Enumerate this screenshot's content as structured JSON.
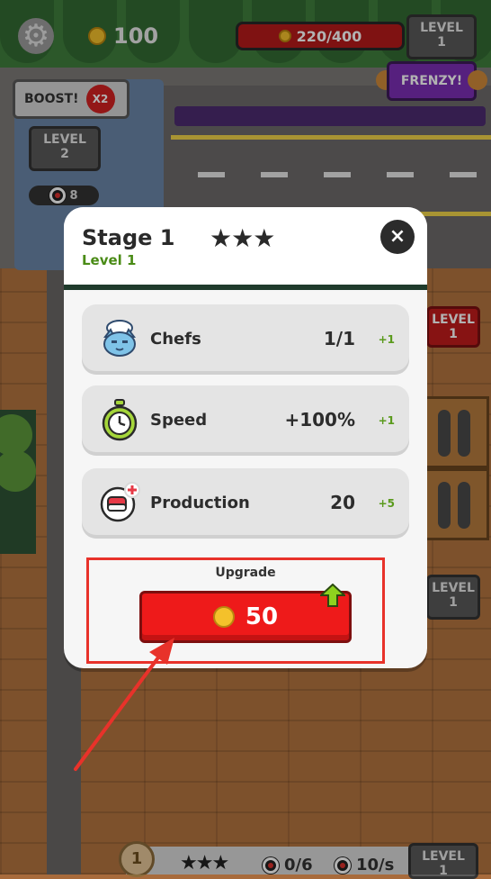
{
  "hud": {
    "coins": "100",
    "progress": "220/400",
    "level_label": "LEVEL",
    "level_value": "1",
    "frenzy": "FRENZY!"
  },
  "building": {
    "boost_label": "BOOST!",
    "boost_multiplier": "X2",
    "level_label": "LEVEL",
    "level_value": "2",
    "count": "8"
  },
  "side": {
    "red_level_label": "LEVEL",
    "red_level_value": "1",
    "gray_level_label": "LEVEL",
    "gray_level_value": "1"
  },
  "modal": {
    "title": "Stage 1",
    "subtitle": "Level 1",
    "stars": "★★★",
    "close_icon": "×",
    "stats": [
      {
        "icon": "chef-cat-icon",
        "label": "Chefs",
        "value": "1/1",
        "increment": "+1"
      },
      {
        "icon": "stopwatch-icon",
        "label": "Speed",
        "value": "+100%",
        "increment": "+1"
      },
      {
        "icon": "sushi-production-icon",
        "label": "Production",
        "value": "20",
        "increment": "+5"
      }
    ],
    "upgrade_label": "Upgrade",
    "upgrade_cost": "50"
  },
  "bottom": {
    "badge": "1",
    "stars": "★★★",
    "stock": "0/6",
    "rate": "10/s",
    "level_label": "LEVEL",
    "level_value": "1"
  },
  "colors": {
    "accent_red": "#ee1a1a",
    "level_green": "#4a8b16",
    "highlight": "#e8322a"
  }
}
